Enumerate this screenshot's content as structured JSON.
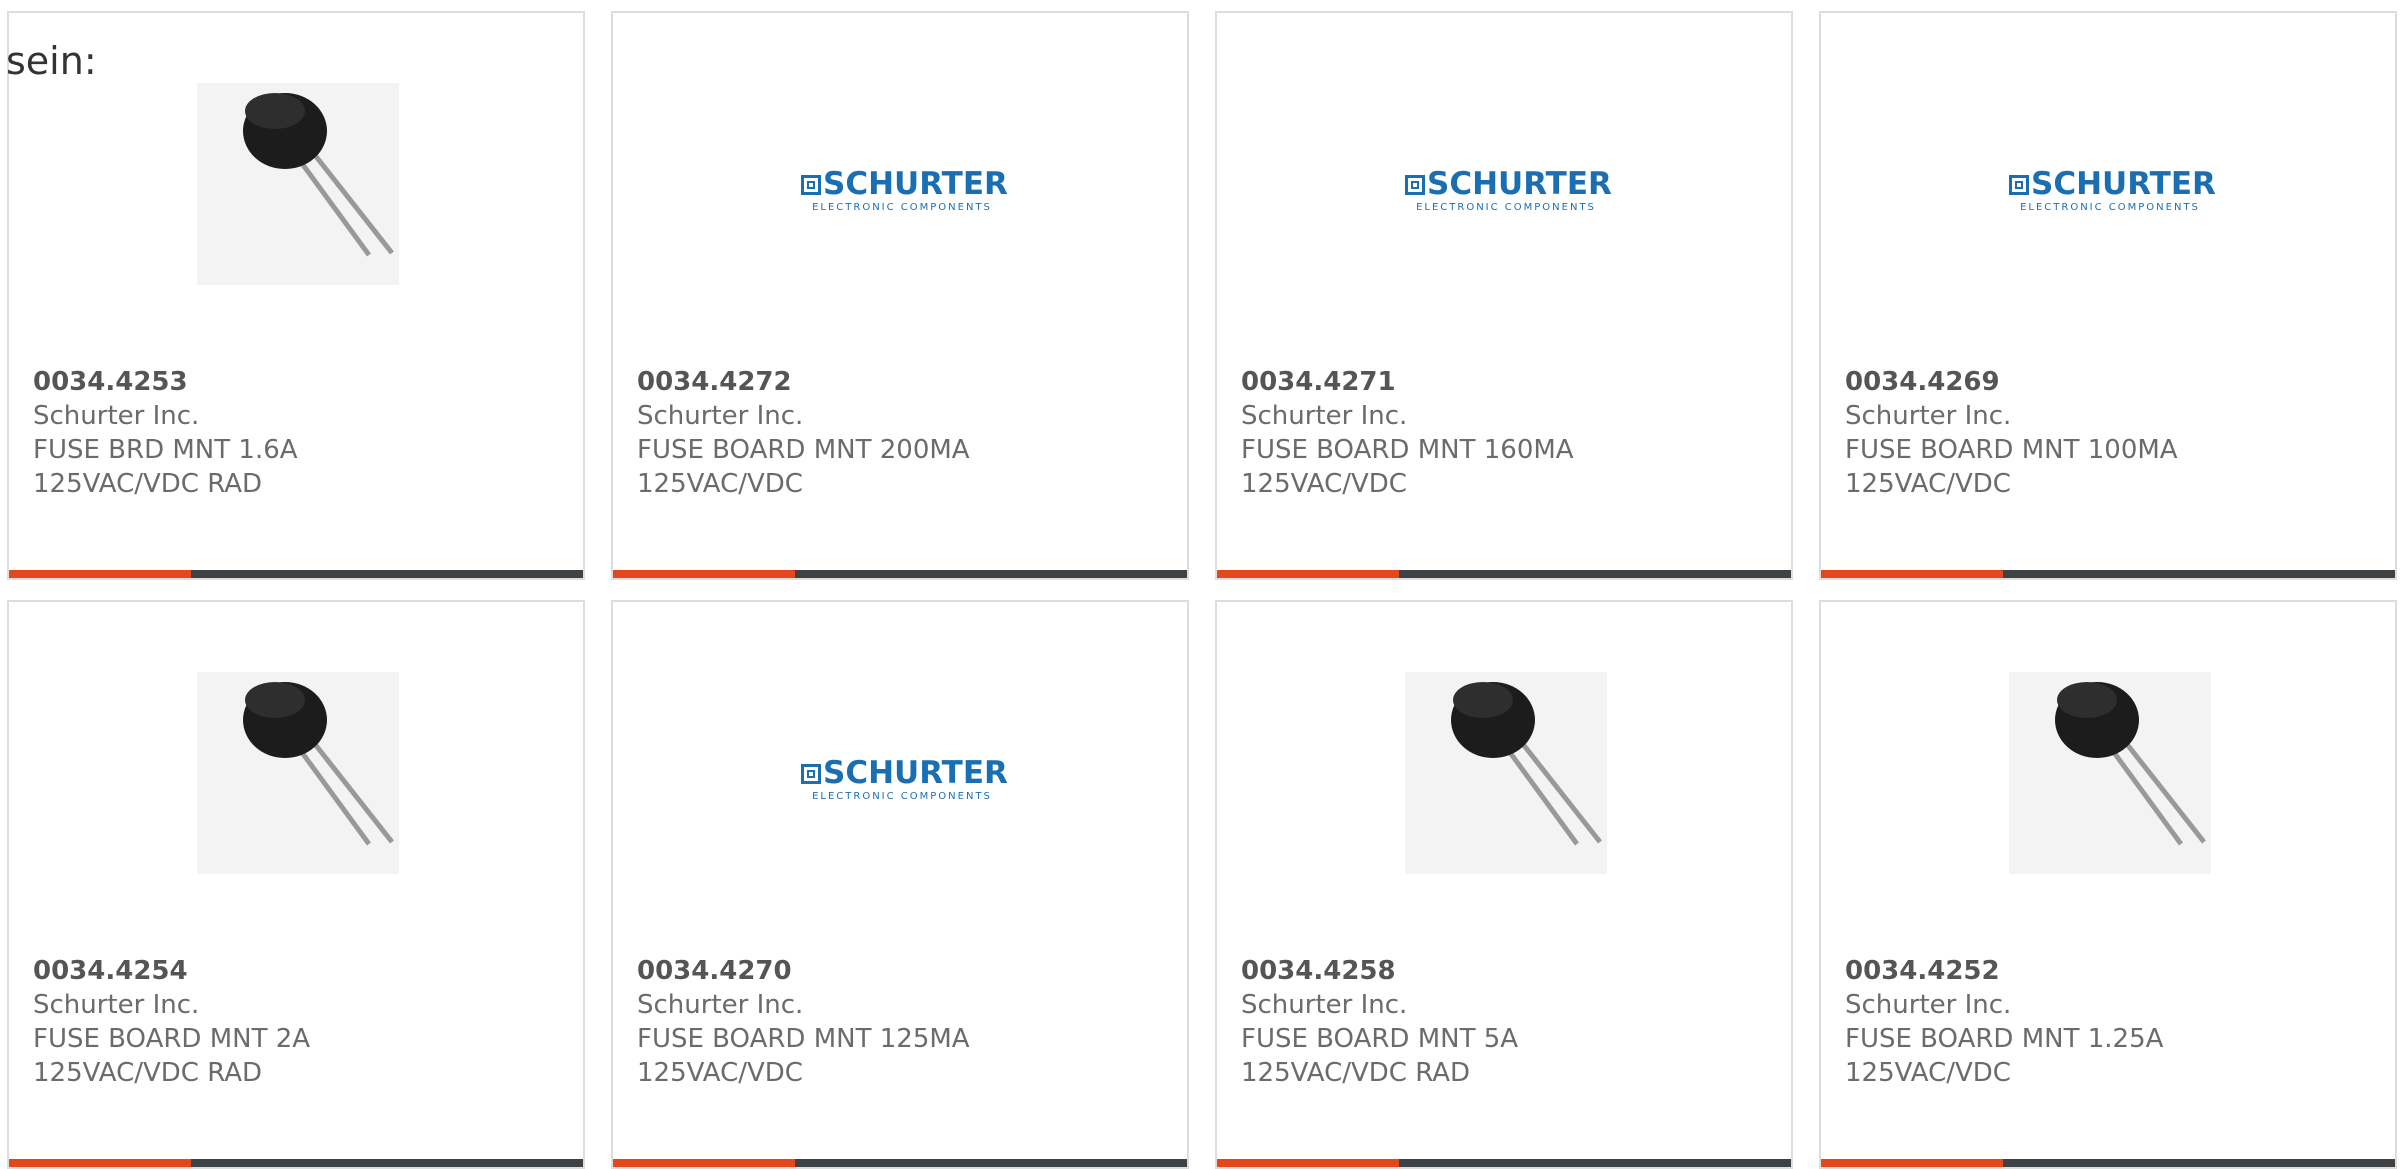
{
  "intro_text": "sein:",
  "colors": {
    "accent": "#e2481c",
    "bar": "#3f4244",
    "logo_blue": "#1a6fb3"
  },
  "logo": {
    "word": "SCHURTER",
    "tagline": "ELECTRONIC COMPONENTS"
  },
  "products": [
    {
      "part_number": "0034.4253",
      "manufacturer": "Schurter Inc.",
      "desc_line1": "FUSE BRD MNT 1.6A",
      "desc_line2": "125VAC/VDC RAD",
      "image": "fuse-photo"
    },
    {
      "part_number": "0034.4272",
      "manufacturer": "Schurter Inc.",
      "desc_line1": "FUSE BOARD MNT 200MA",
      "desc_line2": "125VAC/VDC",
      "image": "schurter-logo"
    },
    {
      "part_number": "0034.4271",
      "manufacturer": "Schurter Inc.",
      "desc_line1": "FUSE BOARD MNT 160MA",
      "desc_line2": "125VAC/VDC",
      "image": "schurter-logo"
    },
    {
      "part_number": "0034.4269",
      "manufacturer": "Schurter Inc.",
      "desc_line1": "FUSE BOARD MNT 100MA",
      "desc_line2": "125VAC/VDC",
      "image": "schurter-logo"
    },
    {
      "part_number": "0034.4254",
      "manufacturer": "Schurter Inc.",
      "desc_line1": "FUSE BOARD MNT 2A",
      "desc_line2": "125VAC/VDC RAD",
      "image": "fuse-photo"
    },
    {
      "part_number": "0034.4270",
      "manufacturer": "Schurter Inc.",
      "desc_line1": "FUSE BOARD MNT 125MA",
      "desc_line2": "125VAC/VDC",
      "image": "schurter-logo"
    },
    {
      "part_number": "0034.4258",
      "manufacturer": "Schurter Inc.",
      "desc_line1": "FUSE BOARD MNT 5A",
      "desc_line2": "125VAC/VDC RAD",
      "image": "fuse-photo"
    },
    {
      "part_number": "0034.4252",
      "manufacturer": "Schurter Inc.",
      "desc_line1": "FUSE BOARD MNT 1.25A",
      "desc_line2": "125VAC/VDC",
      "image": "fuse-photo"
    }
  ]
}
